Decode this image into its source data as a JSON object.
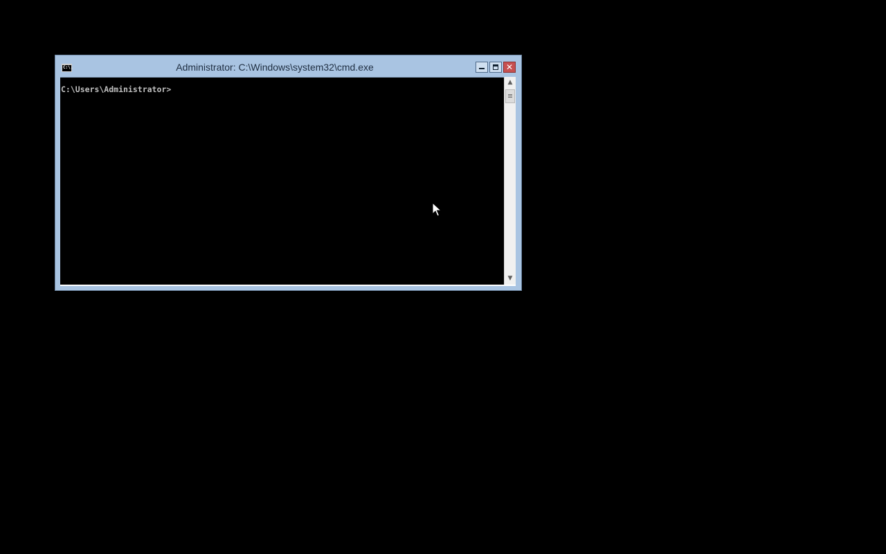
{
  "window": {
    "title": "Administrator: C:\\Windows\\system32\\cmd.exe",
    "icon": "cmd-icon",
    "icon_text": "C:\\.",
    "controls": {
      "minimize": "minimize-icon",
      "maximize": "maximize-icon",
      "close_glyph": "✕"
    }
  },
  "console": {
    "prompt": "C:\\Users\\Administrator>",
    "text_color": "#c0c0c0",
    "background_color": "#000000"
  },
  "scrollbar": {
    "up_arrow": "▲",
    "down_arrow": "▼"
  },
  "colors": {
    "frame": "#a9c4e2",
    "close_button": "#c75050",
    "desktop": "#000000"
  },
  "pointer": "mouse-pointer-icon"
}
